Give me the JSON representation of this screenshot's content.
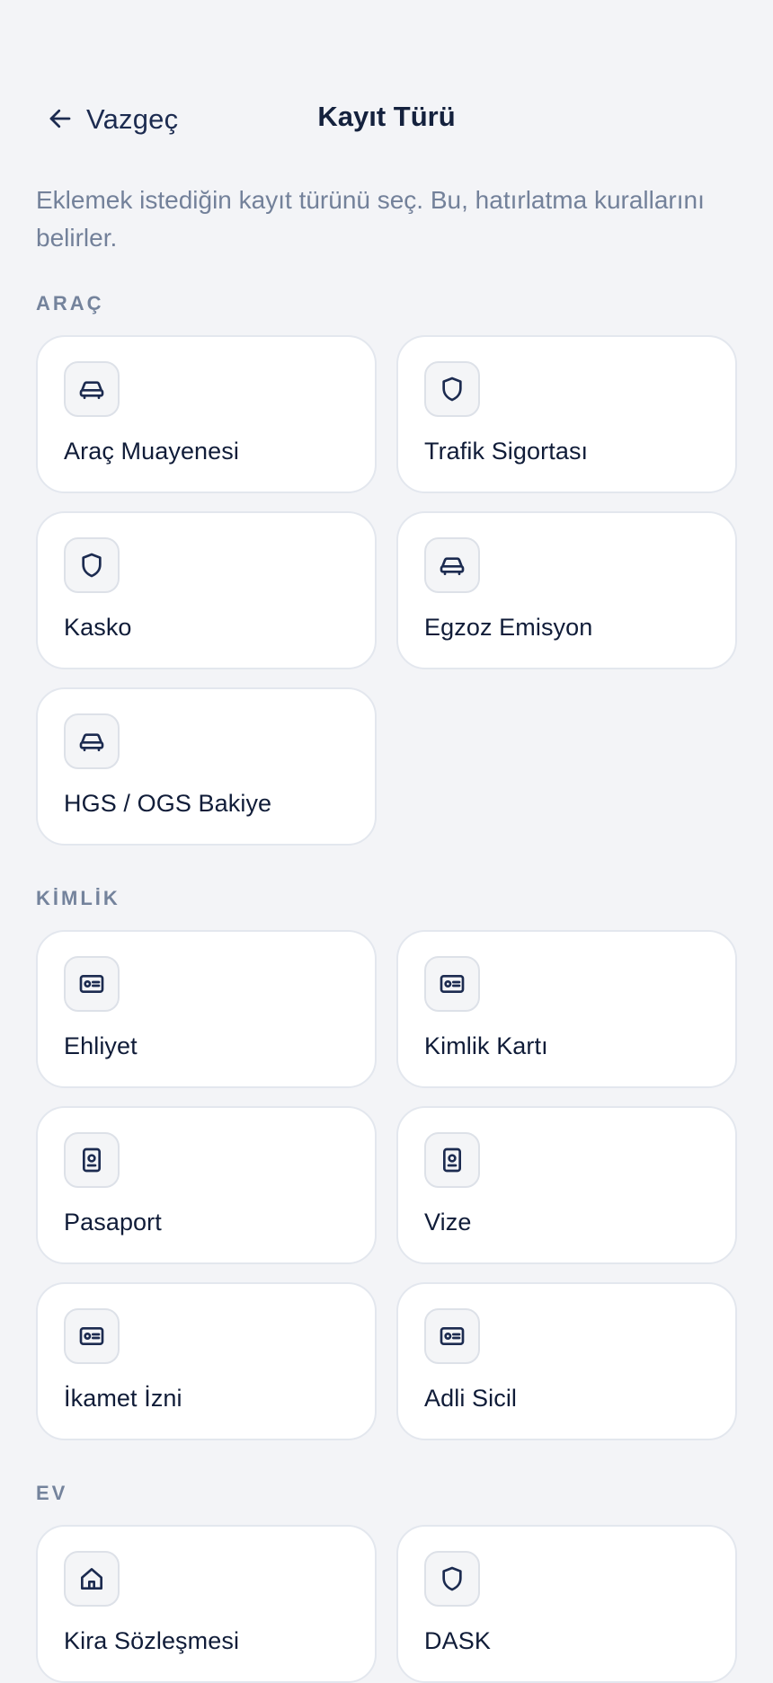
{
  "header": {
    "back_label": "Vazgeç",
    "title": "Kayıt Türü"
  },
  "description": "Eklemek istediğin kayıt türünü seç. Bu, hatırlatma kurallarını belirler.",
  "sections": [
    {
      "title": "ARAÇ",
      "items": [
        {
          "label": "Araç Muayenesi",
          "icon": "car-icon"
        },
        {
          "label": "Trafik Sigortası",
          "icon": "shield-icon"
        },
        {
          "label": "Kasko",
          "icon": "shield-icon"
        },
        {
          "label": "Egzoz Emisyon",
          "icon": "car-icon"
        },
        {
          "label": "HGS / OGS Bakiye",
          "icon": "car-icon"
        }
      ]
    },
    {
      "title": "KİMLİK",
      "items": [
        {
          "label": "Ehliyet",
          "icon": "id-card-icon"
        },
        {
          "label": "Kimlik Kartı",
          "icon": "id-card-icon"
        },
        {
          "label": "Pasaport",
          "icon": "passport-icon"
        },
        {
          "label": "Vize",
          "icon": "passport-icon"
        },
        {
          "label": "İkamet İzni",
          "icon": "id-card-icon"
        },
        {
          "label": "Adli Sicil",
          "icon": "id-card-icon"
        }
      ]
    },
    {
      "title": "EV",
      "items": [
        {
          "label": "Kira Sözleşmesi",
          "icon": "home-icon"
        },
        {
          "label": "DASK",
          "icon": "shield-icon"
        }
      ]
    }
  ],
  "colors": {
    "background": "#f3f4f7",
    "card": "#ffffff",
    "text_primary": "#101c38",
    "text_secondary": "#73819a"
  }
}
